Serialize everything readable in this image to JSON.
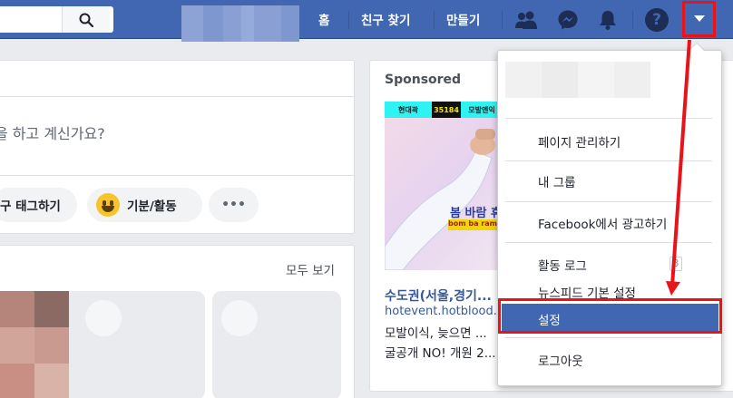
{
  "topbar": {
    "nav_home": "홈",
    "nav_find_friends": "친구 찾기",
    "nav_create": "만들기",
    "help_glyph": "?"
  },
  "composer": {
    "prompt": "을 하고 계신가요?",
    "tag_label": "구 태그하기",
    "feeling_label": "기분/활동",
    "more_label": "•••"
  },
  "stories": {
    "see_all": "모두 보기"
  },
  "sponsored": {
    "label": "Sponsored",
    "ad_badge_1": "현대곽",
    "ad_badge_2": "35184",
    "ad_badge_3": "모발엔익",
    "ad_caption": "봄 바람 휴",
    "ad_sub": "bom ba ram h",
    "title": "수도권(서울,경기...",
    "url": "hotevent.hotblood...",
    "line1": "모발이식, 늦으면 ...",
    "line2": "굴공개 NO! 개원 2..."
  },
  "dropdown": {
    "items": [
      "페이지 관리하기",
      "내 그룹",
      "Facebook에서 광고하기",
      "활동 로그",
      "뉴스피드 기본 설정",
      "설정",
      "로그아웃"
    ],
    "activity_badge": "3"
  },
  "colors": {
    "brand": "#4267b2",
    "highlight": "#e8141a"
  }
}
